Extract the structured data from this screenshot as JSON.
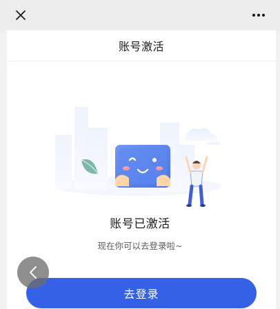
{
  "nav": {
    "close_icon": "close-icon",
    "more_icon": "more-horizontal-icon"
  },
  "header": {
    "title": "账号激活"
  },
  "result": {
    "title": "账号已激活",
    "subtitle": "现在你可以去登录啦~"
  },
  "actions": {
    "login_label": "去登录"
  },
  "floating": {
    "back_icon": "chevron-left-icon"
  },
  "colors": {
    "accent": "#3461e5",
    "topbar": "#ededed"
  }
}
